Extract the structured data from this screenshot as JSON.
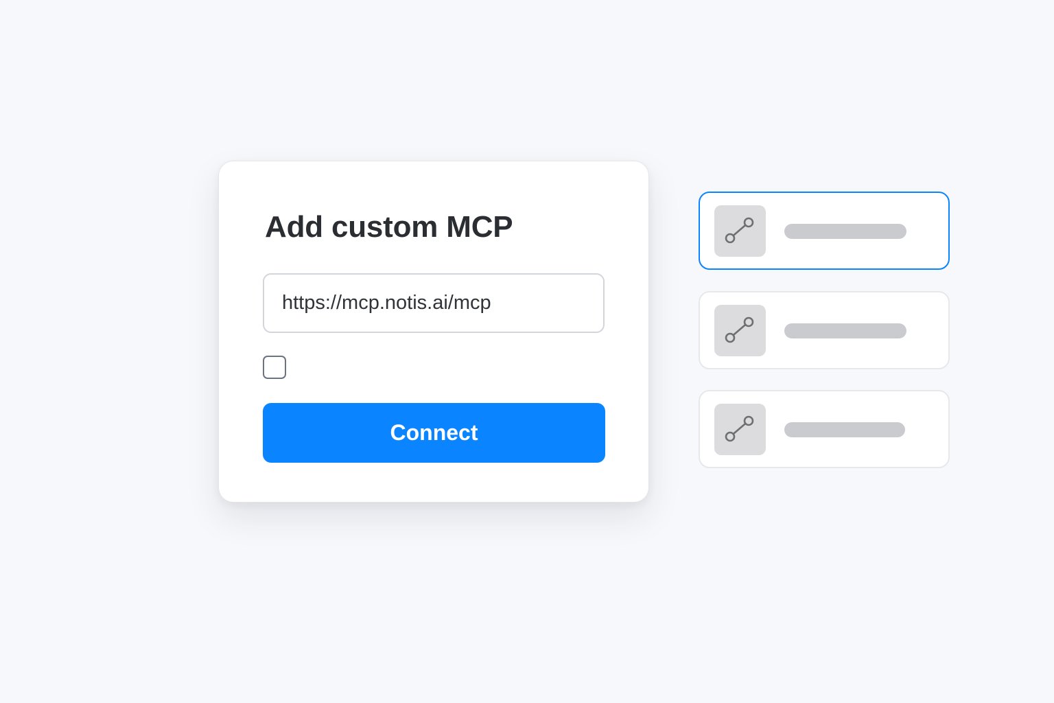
{
  "dialog": {
    "title": "Add custom MCP",
    "url_input": {
      "value": "https://mcp.notis.ai/mcp",
      "placeholder": ""
    },
    "checkbox": {
      "checked": false
    },
    "connect_button": {
      "label": "Connect"
    }
  },
  "server_list": {
    "items": [
      {
        "icon": "connection-icon",
        "selected": true
      },
      {
        "icon": "connection-icon",
        "selected": false
      },
      {
        "icon": "connection-icon",
        "selected": false
      }
    ]
  },
  "colors": {
    "accent": "#0a84ff",
    "background": "#f7f8fb",
    "card": "#ffffff",
    "title_text": "#2a2d31",
    "icon_tile": "#dcdcde",
    "placeholder_bar": "#cacbce"
  }
}
